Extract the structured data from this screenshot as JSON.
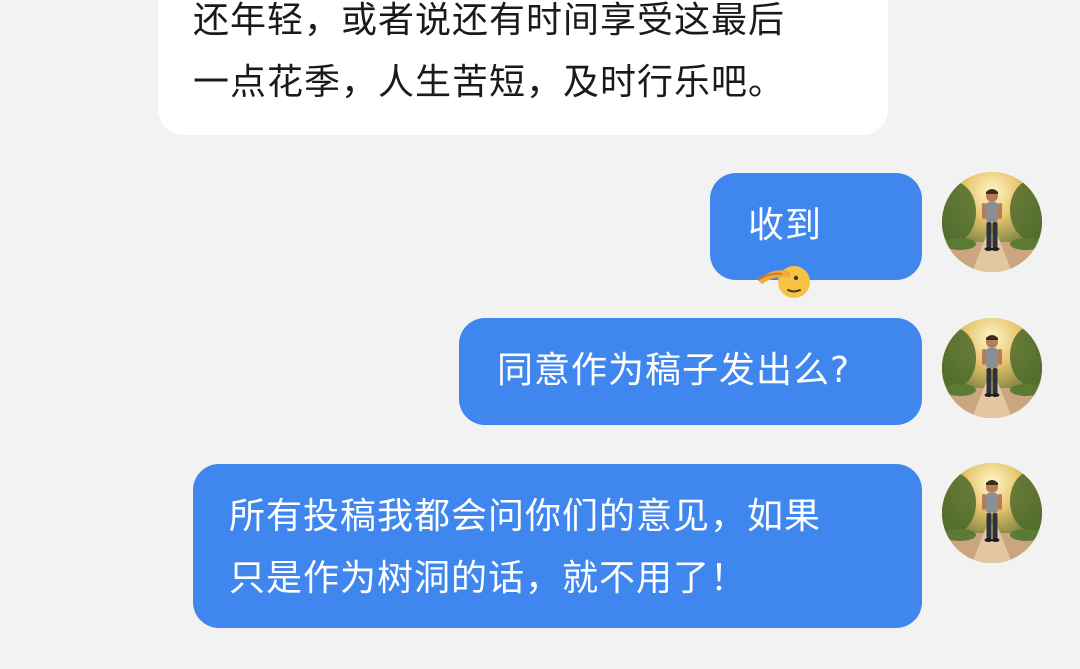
{
  "messages": [
    {
      "sender": "other",
      "lines": [
        "还年轻，或者说还有时间享受这最后",
        "一点花季，人生苦短，及时行乐吧。"
      ]
    },
    {
      "sender": "self",
      "text": "收到",
      "emoji": "saluting-face-icon"
    },
    {
      "sender": "self",
      "text": "同意作为稿子发出么?"
    },
    {
      "sender": "self",
      "lines": [
        "所有投稿我都会问你们的意见，如果",
        "只是作为树洞的话，就不用了！"
      ]
    }
  ],
  "colors": {
    "background": "#f2f2f2",
    "incoming_bubble": "#ffffff",
    "outgoing_bubble": "#3f86ee",
    "outgoing_text": "#ffffff",
    "incoming_text": "#1a1a1a"
  },
  "avatar": {
    "icon": "user-avatar-photo"
  }
}
